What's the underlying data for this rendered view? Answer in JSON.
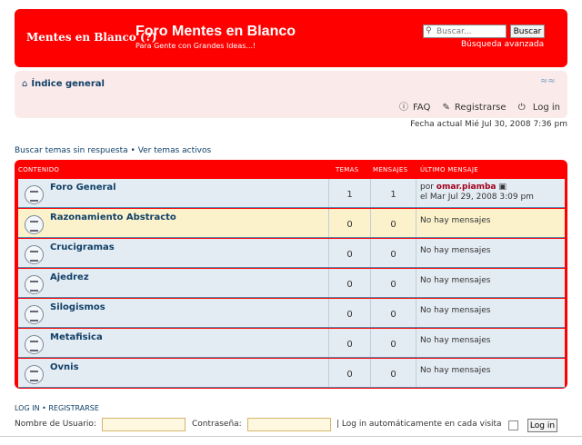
{
  "header": {
    "logo_text": "Mentes en Blanco (?)",
    "site_title": "Foro Mentes en Blanco",
    "site_description": "Para Gente con Grandes Ideas...!",
    "search_placeholder": "Buscar...",
    "search_button": "Buscar",
    "advanced_search": "Búsqueda avanzada"
  },
  "navbar": {
    "index_label": "Índice general",
    "faq": "FAQ",
    "register": "Registrarse",
    "login": "Log in"
  },
  "current_time": "Fecha actual Mié Jul 30, 2008 7:36 pm",
  "quick_links": "Buscar temas sin respuesta • Ver temas activos",
  "table": {
    "col_forum": "CONTENIDO",
    "col_topics": "TEMAS",
    "col_posts": "MENSAJES",
    "col_last": "ÚLTIMO MENSAJE",
    "forums": [
      {
        "name": "Foro General",
        "topics": "1",
        "posts": "1",
        "last_prefix": "por",
        "last_author": "omar.piamba",
        "last_date": "el Mar Jul 29, 2008 3:09 pm"
      },
      {
        "name": "Razonamiento Abstracto",
        "topics": "0",
        "posts": "0",
        "last": "No hay mensajes"
      },
      {
        "name": "Crucigramas",
        "topics": "0",
        "posts": "0",
        "last": "No hay mensajes"
      },
      {
        "name": "Ajedrez",
        "topics": "0",
        "posts": "0",
        "last": "No hay mensajes"
      },
      {
        "name": "Silogismos",
        "topics": "0",
        "posts": "0",
        "last": "No hay mensajes"
      },
      {
        "name": "Metafisica",
        "topics": "0",
        "posts": "0",
        "last": "No hay mensajes"
      },
      {
        "name": "Ovnis",
        "topics": "0",
        "posts": "0",
        "last": "No hay mensajes"
      }
    ]
  },
  "login": {
    "heading": "LOG IN  •  REGISTRARSE",
    "username_label": "Nombre de Usuario:",
    "password_label": "Contraseña:",
    "autologin_label": "| Log in automáticamente en cada visita",
    "button": "Log in"
  }
}
